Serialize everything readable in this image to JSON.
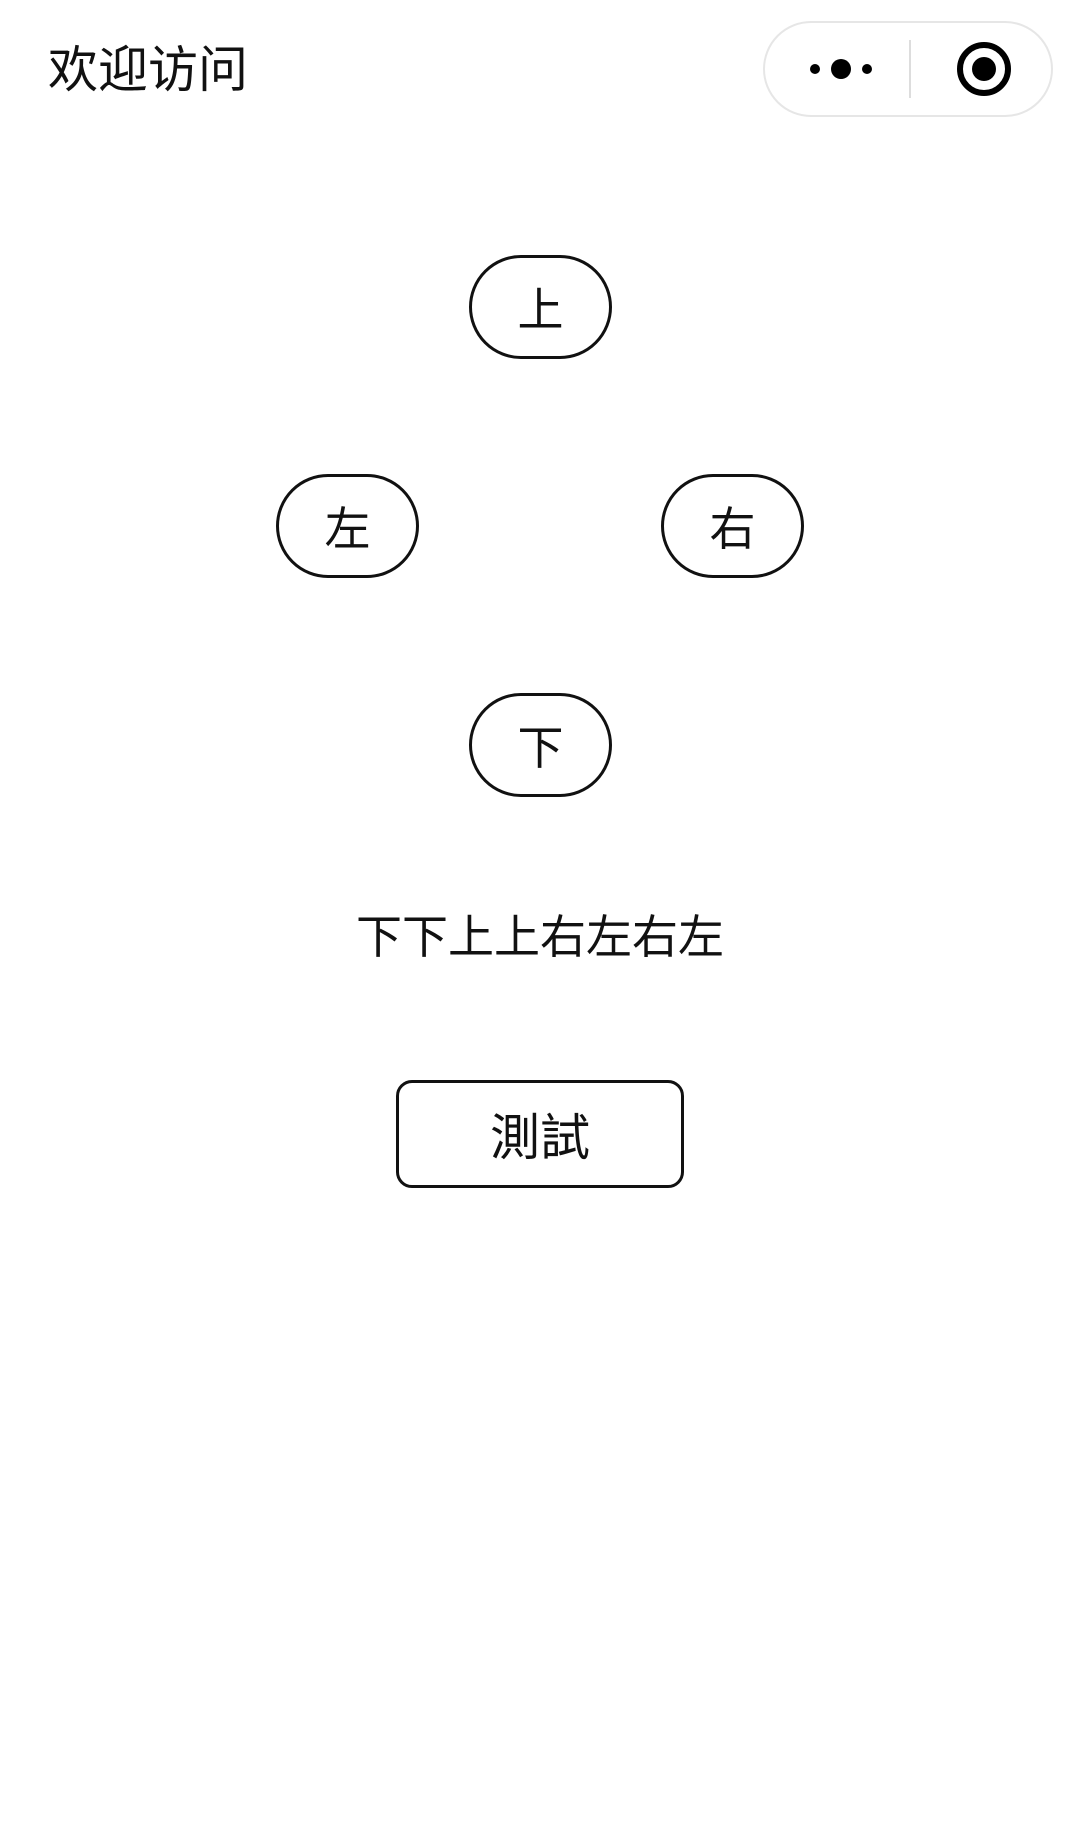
{
  "nav": {
    "title": "欢迎访问",
    "capsule": {
      "more_icon": "more-dots-icon",
      "close_icon": "target-circle-icon"
    }
  },
  "controls": {
    "up_label": "上",
    "left_label": "左",
    "right_label": "右",
    "down_label": "下"
  },
  "sequence_text": "下下上上右左右左",
  "test_button_label": "測試",
  "colors": {
    "background": "#ffffff",
    "text": "#111111",
    "border": "#111111",
    "capsule_border": "#e6e6e6"
  }
}
